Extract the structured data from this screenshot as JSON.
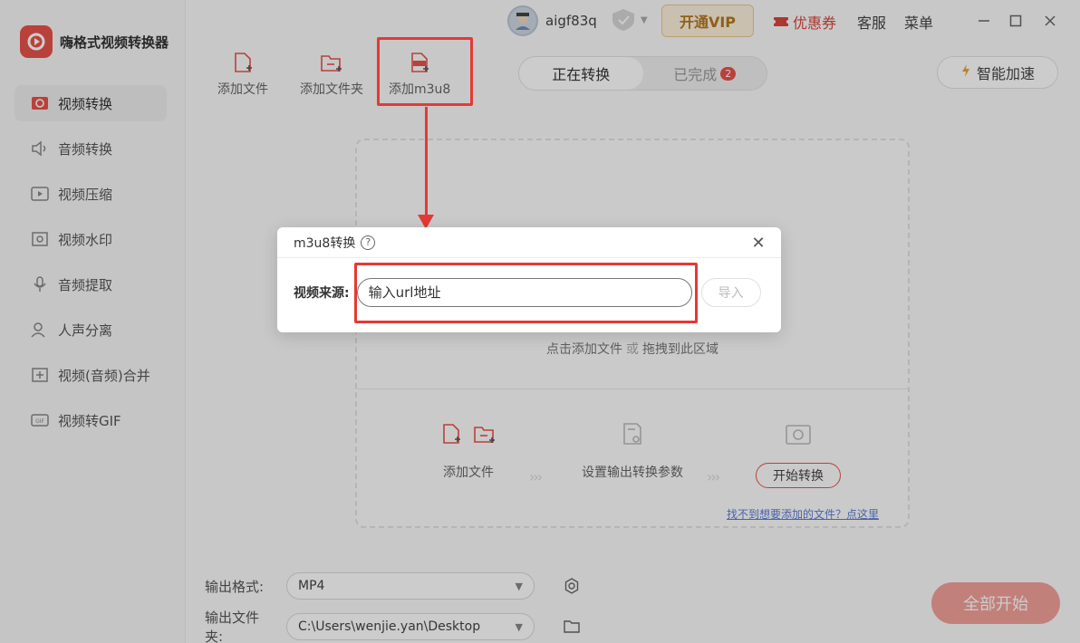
{
  "app": {
    "name": "嗨格式视频转换器",
    "brand_color": "#e8524a"
  },
  "sidebar": {
    "items": [
      {
        "label": "视频转换",
        "icon": "video-convert-icon",
        "active": true
      },
      {
        "label": "音频转换",
        "icon": "audio-convert-icon"
      },
      {
        "label": "视频压缩",
        "icon": "video-compress-icon"
      },
      {
        "label": "视频水印",
        "icon": "video-watermark-icon"
      },
      {
        "label": "音频提取",
        "icon": "audio-extract-icon"
      },
      {
        "label": "人声分离",
        "icon": "vocal-separation-icon"
      },
      {
        "label": "视频(音频)合并",
        "icon": "merge-icon"
      },
      {
        "label": "视频转GIF",
        "icon": "gif-icon"
      }
    ]
  },
  "titlebar": {
    "username": "aigf83q",
    "vip_label": "开通VIP",
    "coupon_label": "优惠券",
    "service_label": "客服",
    "menu_label": "菜单"
  },
  "toolbar": {
    "add_file": "添加文件",
    "add_folder": "添加文件夹",
    "add_m3u8": "添加m3u8"
  },
  "tabs": {
    "converting": "正在转换",
    "completed": "已完成",
    "completed_count": "2"
  },
  "accel_label": "智能加速",
  "drop_area": {
    "hint_left": "点击添加文件",
    "hint_or": "或",
    "hint_right": "拖拽到此区域",
    "step_add": "添加文件",
    "step_settings": "设置输出转换参数",
    "step_start": "开始转换",
    "help_link": "找不到想要添加的文件？点这里"
  },
  "bottom": {
    "format_label": "输出格式:",
    "format_value": "MP4",
    "folder_label": "输出文件夹:",
    "folder_value": "C:\\Users\\wenjie.yan\\Desktop",
    "start_all": "全部开始"
  },
  "modal": {
    "title": "m3u8转换",
    "help_glyph": "?",
    "close_glyph": "✕",
    "source_label": "视频来源:",
    "url_placeholder": "输入url地址",
    "import_label": "导入"
  },
  "annotation_color": "#e53935"
}
